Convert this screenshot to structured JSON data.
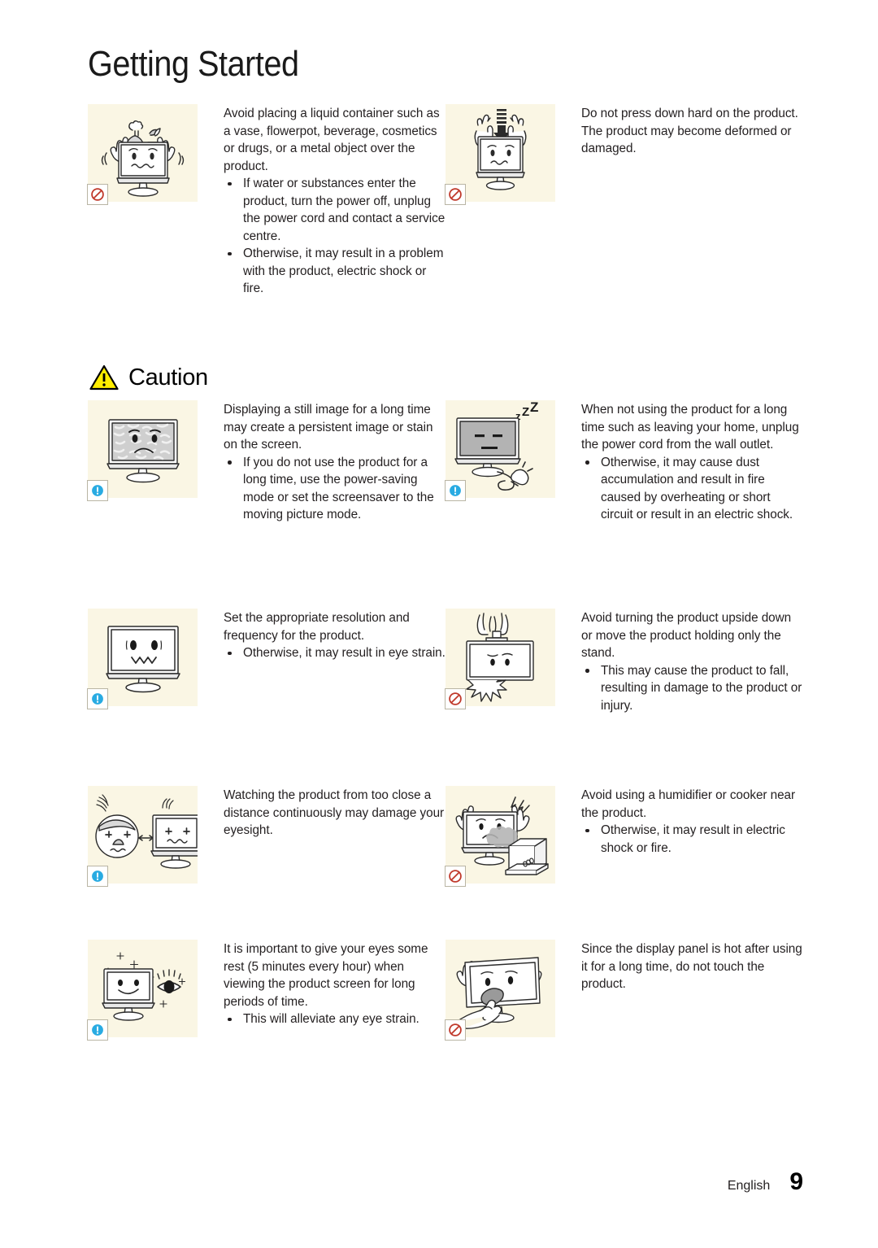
{
  "header": {
    "title": "Getting Started"
  },
  "caution": {
    "label": "Caution",
    "icon": "warning-triangle-icon"
  },
  "badges": {
    "prohibited": "prohibition-icon",
    "info": "info-exclamation-icon"
  },
  "colors": {
    "figure_background": "#faf6e4",
    "prohibition_red": "#c0392b",
    "info_blue": "#29abe2",
    "caution_yellow": "#ffed00",
    "text": "#231f20",
    "page_background": "#ffffff"
  },
  "items": [
    {
      "id": "liquid-container",
      "badge": "prohibited",
      "illustration": "monitor-with-vase-and-glass",
      "lead": "Avoid placing a liquid container such as a vase, flowerpot, beverage, cosmetics or drugs, or a metal object over the product.",
      "bullets": [
        "If water or substances enter the product, turn the power off, unplug the power cord and contact a service centre.",
        "Otherwise, it may result in a problem with the product, electric shock or fire."
      ]
    },
    {
      "id": "press-down-hard",
      "badge": "prohibited",
      "illustration": "monitor-pressed-by-hands-with-arrow",
      "lead": "Do not press down hard on the product. The product may become deformed or damaged.",
      "bullets": []
    },
    {
      "id": "still-image",
      "badge": "info",
      "illustration": "monitor-with-burn-in-screen",
      "lead": "Displaying a still image for a long time may create a persistent image or stain on the screen.",
      "bullets": [
        "If you do not use the product for a long time, use the power-saving mode or set the screensaver to the moving picture mode."
      ]
    },
    {
      "id": "unplug-when-away",
      "badge": "info",
      "illustration": "sleeping-monitor-with-unplugged-cord",
      "lead": "When not using the product for a long time such as leaving your home, unplug the power cord from the wall outlet.",
      "bullets": [
        "Otherwise, it may cause dust accumulation and result in fire caused by overheating or short circuit or result in an electric shock."
      ]
    },
    {
      "id": "resolution-frequency",
      "badge": "info",
      "illustration": "monitor-with-dizzy-face",
      "lead": "Set the appropriate resolution and frequency for the product.",
      "bullets": [
        "Otherwise, it may result in eye strain."
      ]
    },
    {
      "id": "upside-down",
      "badge": "prohibited",
      "illustration": "monitor-upside-down-falling",
      "lead": "Avoid turning the product upside down or move the product holding only the stand.",
      "bullets": [
        "This may cause the product to fall, resulting in damage to the product or injury."
      ]
    },
    {
      "id": "viewing-distance",
      "badge": "info",
      "illustration": "face-too-close-to-monitor",
      "lead": "Watching the product from too close a distance continuously may damage your eyesight.",
      "bullets": []
    },
    {
      "id": "humidifier-cooker",
      "badge": "prohibited",
      "illustration": "monitor-next-to-steaming-cooker",
      "lead": "Avoid using a humidifier or cooker near the product.",
      "bullets": [
        "Otherwise, it may result in electric shock or fire."
      ]
    },
    {
      "id": "eye-rest",
      "badge": "info",
      "illustration": "happy-monitor-with-sparkling-eye",
      "lead": "It is important to give your eyes some rest (5 minutes every hour) when viewing the product screen for long periods of time.",
      "bullets": [
        "This will alleviate any eye strain."
      ]
    },
    {
      "id": "hot-panel",
      "badge": "prohibited",
      "illustration": "hand-touching-hot-panel",
      "lead": "Since the display panel is hot after using it for a long time, do not touch the product.",
      "bullets": []
    }
  ],
  "footer": {
    "language": "English",
    "page_number": "9"
  }
}
